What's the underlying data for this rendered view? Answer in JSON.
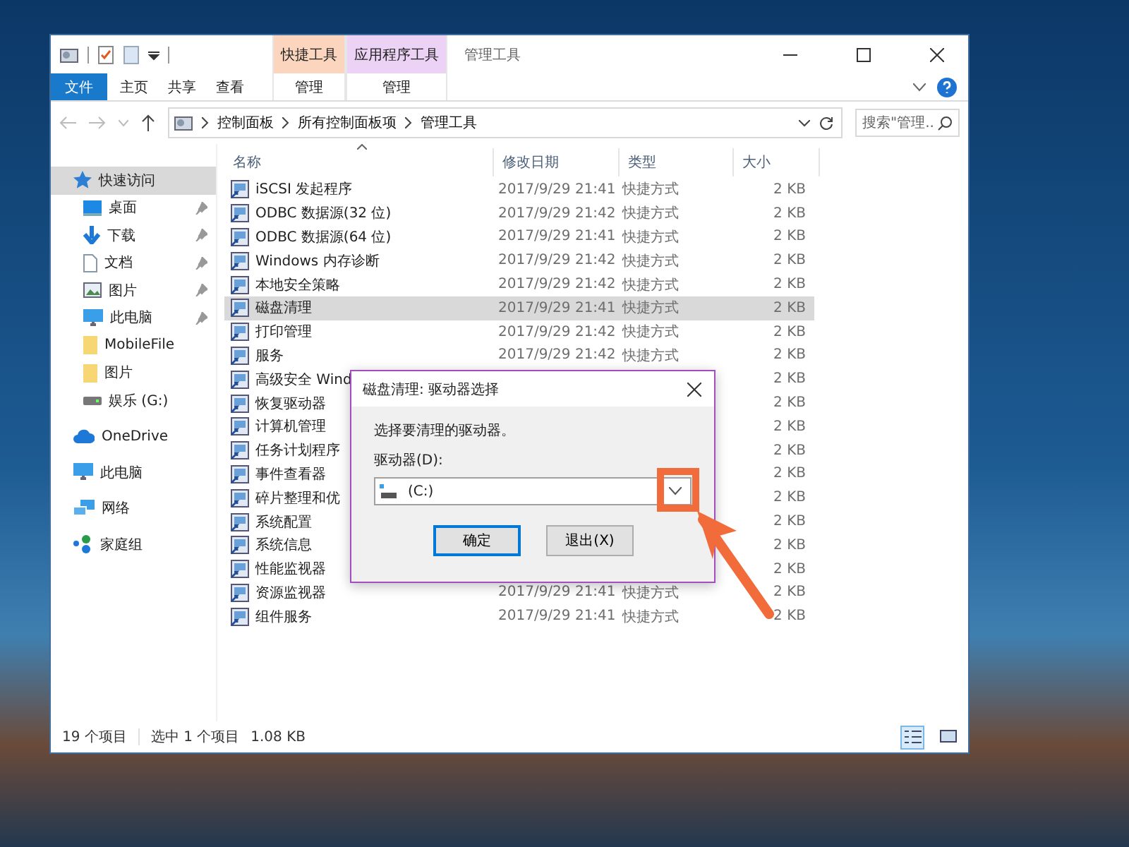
{
  "window": {
    "title": "管理工具",
    "context_groups": [
      {
        "header": "快捷工具",
        "tab": {
          "label": "管理",
          "selected": false
        },
        "color": "#fbd5bd"
      },
      {
        "header": "应用程序工具",
        "tab": {
          "label": "管理",
          "selected": false
        },
        "color": "#ecd2f5"
      }
    ]
  },
  "ribbon_tabs": [
    {
      "label": "文件",
      "kind": "file",
      "selected": false
    },
    {
      "label": "主页",
      "kind": "tab",
      "selected": false
    },
    {
      "label": "共享",
      "kind": "tab",
      "selected": false
    },
    {
      "label": "查看",
      "kind": "tab",
      "selected": false
    }
  ],
  "address_bar": {
    "path": [
      "控制面板",
      "所有控制面板项",
      "管理工具"
    ]
  },
  "search": {
    "placeholder": "搜索\"管理..."
  },
  "sidebar": {
    "groups": [
      {
        "items": [
          {
            "label": "快速访问",
            "kind": "star",
            "selected": true,
            "pinned": false
          },
          {
            "label": "桌面",
            "kind": "desktop",
            "selected": false,
            "pinned": true
          },
          {
            "label": "下载",
            "kind": "download",
            "selected": false,
            "pinned": true
          },
          {
            "label": "文档",
            "kind": "document",
            "selected": false,
            "pinned": true
          },
          {
            "label": "图片",
            "kind": "picture",
            "selected": false,
            "pinned": true
          },
          {
            "label": "此电脑",
            "kind": "computer",
            "selected": false,
            "pinned": true
          },
          {
            "label": "MobileFile",
            "kind": "folder",
            "selected": false,
            "pinned": false
          },
          {
            "label": "图片",
            "kind": "folder",
            "selected": false,
            "pinned": false
          },
          {
            "label": "娱乐 (G:)",
            "kind": "drive",
            "selected": false,
            "pinned": false
          }
        ]
      },
      {
        "items": [
          {
            "label": "OneDrive",
            "kind": "cloud",
            "selected": false,
            "pinned": false
          }
        ]
      },
      {
        "items": [
          {
            "label": "此电脑",
            "kind": "computer",
            "selected": false,
            "pinned": false
          }
        ]
      },
      {
        "items": [
          {
            "label": "网络",
            "kind": "network",
            "selected": false,
            "pinned": false
          }
        ]
      },
      {
        "items": [
          {
            "label": "家庭组",
            "kind": "homegroup",
            "selected": false,
            "pinned": false
          }
        ]
      }
    ]
  },
  "table": {
    "columns": [
      "名称",
      "修改日期",
      "类型",
      "大小"
    ],
    "rows": [
      {
        "name": "iSCSI 发起程序",
        "date": "2017/9/29 21:41",
        "type": "快捷方式",
        "size": "2 KB",
        "selected": false
      },
      {
        "name": "ODBC 数据源(32 位)",
        "date": "2017/9/29 21:42",
        "type": "快捷方式",
        "size": "2 KB",
        "selected": false
      },
      {
        "name": "ODBC 数据源(64 位)",
        "date": "2017/9/29 21:41",
        "type": "快捷方式",
        "size": "2 KB",
        "selected": false
      },
      {
        "name": "Windows 内存诊断",
        "date": "2017/9/29 21:42",
        "type": "快捷方式",
        "size": "2 KB",
        "selected": false
      },
      {
        "name": "本地安全策略",
        "date": "2017/9/29 21:42",
        "type": "快捷方式",
        "size": "2 KB",
        "selected": false
      },
      {
        "name": "磁盘清理",
        "date": "2017/9/29 21:41",
        "type": "快捷方式",
        "size": "2 KB",
        "selected": true
      },
      {
        "name": "打印管理",
        "date": "2017/9/29 21:42",
        "type": "快捷方式",
        "size": "2 KB",
        "selected": false
      },
      {
        "name": "服务",
        "date": "2017/9/29 21:42",
        "type": "快捷方式",
        "size": "2 KB",
        "selected": false
      },
      {
        "name": "高级安全 Wind",
        "size": "2 KB",
        "selected": false
      },
      {
        "name": "恢复驱动器",
        "size": "2 KB",
        "selected": false
      },
      {
        "name": "计算机管理",
        "size": "2 KB",
        "selected": false
      },
      {
        "name": "任务计划程序",
        "size": "2 KB",
        "selected": false
      },
      {
        "name": "事件查看器",
        "size": "2 KB",
        "selected": false
      },
      {
        "name": "碎片整理和优",
        "size": "2 KB",
        "selected": false
      },
      {
        "name": "系统配置",
        "size": "2 KB",
        "selected": false
      },
      {
        "name": "系统信息",
        "size": "2 KB",
        "selected": false
      },
      {
        "name": "性能监视器",
        "size": "2 KB",
        "selected": false
      },
      {
        "name": "资源监视器",
        "date": "2017/9/29 21:41",
        "type": "快捷方式",
        "size": "2 KB",
        "selected": false
      },
      {
        "name": "组件服务",
        "date": "2017/9/29 21:41",
        "type": "快捷方式",
        "size": "2 KB",
        "selected": false
      }
    ]
  },
  "status_bar": {
    "count": "19 个项目",
    "selection": "选中 1 个项目",
    "selection_size": "1.08 KB",
    "view_buttons": [
      {
        "kind": "details",
        "selected": true
      },
      {
        "kind": "large-icons",
        "selected": false
      }
    ]
  },
  "dialog": {
    "title": "磁盘清理: 驱动器选择",
    "prompt": "选择要清理的驱动器。",
    "label": "驱动器(D):",
    "drive": "(C:)",
    "buttons": [
      {
        "label": "确定",
        "default": true
      },
      {
        "label": "退出(X)",
        "default": false
      }
    ]
  }
}
